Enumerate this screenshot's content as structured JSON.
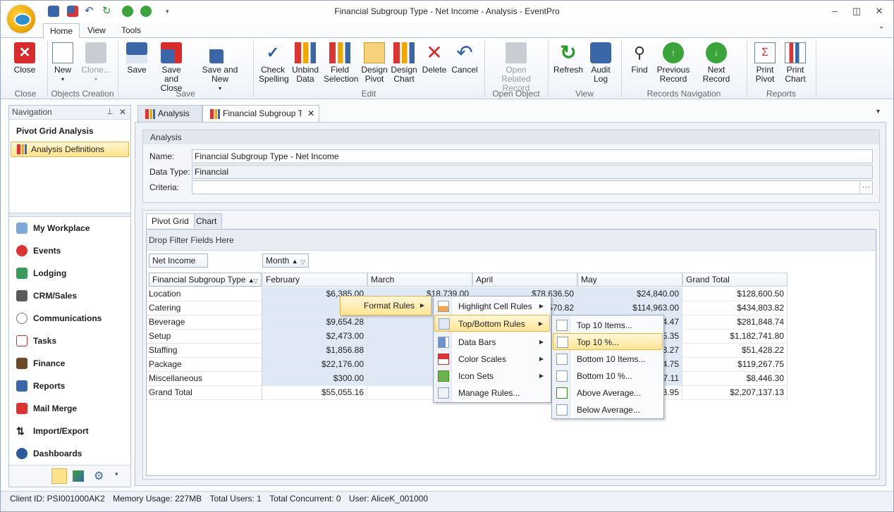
{
  "window": {
    "title": "Financial Subgroup Type - Net Income - Analysis - EventPro"
  },
  "ribbon": {
    "tabs": [
      "Home",
      "View",
      "Tools"
    ],
    "groups": {
      "close": {
        "label": "Close",
        "buttons": [
          "Close"
        ]
      },
      "objects_creation": {
        "label": "Objects Creation",
        "buttons": [
          "New",
          "Clone..."
        ]
      },
      "save": {
        "label": "Save",
        "buttons": [
          "Save",
          "Save and Close",
          "Save and New"
        ]
      },
      "edit": {
        "label": "Edit",
        "buttons": [
          "Check Spelling",
          "Unbind Data",
          "Field Selection",
          "Design Pivot",
          "Design Chart",
          "Delete",
          "Cancel"
        ]
      },
      "open_object": {
        "label": "Open Object",
        "buttons": [
          "Open Related Record"
        ]
      },
      "view": {
        "label": "View",
        "buttons": [
          "Refresh",
          "Audit Log"
        ]
      },
      "records_navigation": {
        "label": "Records Navigation",
        "buttons": [
          "Find",
          "Previous Record",
          "Next Record"
        ]
      },
      "reports": {
        "label": "Reports",
        "buttons": [
          "Print Pivot",
          "Print Chart"
        ]
      }
    }
  },
  "navigation": {
    "header": "Navigation",
    "title": "Pivot Grid Analysis",
    "selected": "Analysis Definitions",
    "items": [
      "My Workplace",
      "Events",
      "Lodging",
      "CRM/Sales",
      "Communications",
      "Tasks",
      "Finance",
      "Reports",
      "Mail Merge",
      "Import/Export",
      "Dashboards"
    ]
  },
  "doc_tabs": [
    "Analysis",
    "Financial Subgroup Type"
  ],
  "analysis": {
    "caption": "Analysis",
    "name_label": "Name:",
    "name_value": "Financial Subgroup Type - Net Income",
    "datatype_label": "Data Type:",
    "datatype_value": "Financial",
    "criteria_label": "Criteria:",
    "criteria_value": "",
    "criteria_btn": "···"
  },
  "pivot": {
    "tabs": [
      "Pivot Grid",
      "Chart"
    ],
    "drop_filter": "Drop Filter Fields Here",
    "data_field": "Net Income",
    "column_field": "Month",
    "row_field": "Financial Subgroup Type",
    "columns": [
      "February",
      "March",
      "April",
      "May",
      "Grand Total"
    ],
    "rows": [
      {
        "label": "Location",
        "cells": [
          "$6,385.00",
          "$18,739.00",
          "$78,636.50",
          "$24,840.00",
          "$128,600.50"
        ]
      },
      {
        "label": "Catering",
        "cells": [
          "$12,",
          "",
          "570.82",
          "$114,963.00",
          "$434,803.82"
        ]
      },
      {
        "label": "Beverage",
        "cells": [
          "$9,654.28",
          "$",
          "",
          "4.47",
          "$281,848.74"
        ]
      },
      {
        "label": "Setup",
        "cells": [
          "$2,473.00",
          "$2",
          "",
          "5.35",
          "$1,182,741.80"
        ]
      },
      {
        "label": "Staffing",
        "cells": [
          "$1,856.88",
          "$",
          "",
          "3.27",
          "$51,428.22"
        ]
      },
      {
        "label": "Package",
        "cells": [
          "$22,176.00",
          "$",
          "",
          "4.75",
          "$119,267.75"
        ]
      },
      {
        "label": "Miscellaneous",
        "cells": [
          "$300.00",
          "",
          "",
          "7.11",
          "$8,446.30"
        ]
      },
      {
        "label": "Grand Total",
        "cells": [
          "$55,055.16",
          "$5",
          "",
          "3.95",
          "$2,207,137.13"
        ]
      }
    ]
  },
  "menus": {
    "level1": "Format Rules",
    "level2": [
      "Highlight Cell Rules",
      "Top/Bottom Rules",
      "Data Bars",
      "Color Scales",
      "Icon Sets",
      "Manage Rules..."
    ],
    "level3": [
      "Top 10 Items...",
      "Top 10 %...",
      "Bottom 10 Items...",
      "Bottom 10 %...",
      "Above Average...",
      "Below Average..."
    ]
  },
  "status": {
    "client_id": "Client ID: PSI001000AK2",
    "memory": "Memory Usage: 227MB",
    "users": "Total Users: 1",
    "concurrent": "Total Concurrent: 0",
    "user": "User: AliceK_001000"
  },
  "colors": {
    "accent": "#ffe48a",
    "selection_border": "#e4b64a",
    "frame": "#b9c5d6"
  }
}
